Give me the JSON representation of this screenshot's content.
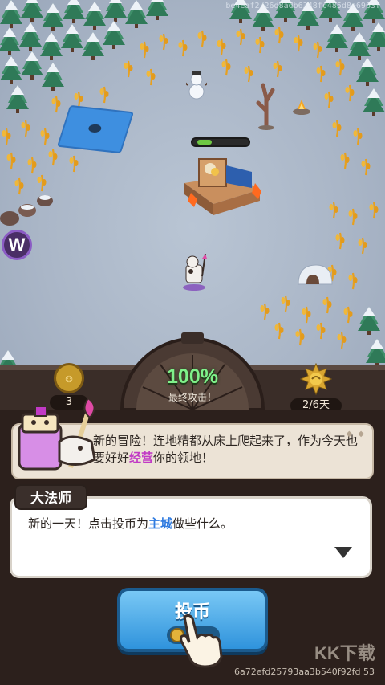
{
  "watermark_top": "be4eaf2/26d8adb6348fc485d8e6963f",
  "map": {
    "hero_flag_color": "#e04aa6"
  },
  "hud": {
    "coins": "3",
    "coin_symbol": "☺",
    "percent": "100%",
    "final_attack_label": "最终攻击！",
    "day_counter": "2/6天"
  },
  "dialog": {
    "message1_part1": "新的冒险！连地精都从床上爬起来了，作为今天也要好好",
    "message1_highlight": "经营",
    "message1_part2": "你的领地！",
    "speaker": "大法师",
    "message2_part1": "新的一天！点击投币为",
    "message2_highlight": "主城",
    "message2_part2": "做些什么。",
    "button_label": "投币"
  },
  "footer": {
    "site_mark": "KK下载",
    "hash": "6a72efd25793aa3b540f92fd 53"
  },
  "colors": {
    "accent_green": "#7ff18a",
    "button_blue": "#2f93dc",
    "highlight_purple": "#c13ac5",
    "highlight_blue": "#2f7be0"
  }
}
